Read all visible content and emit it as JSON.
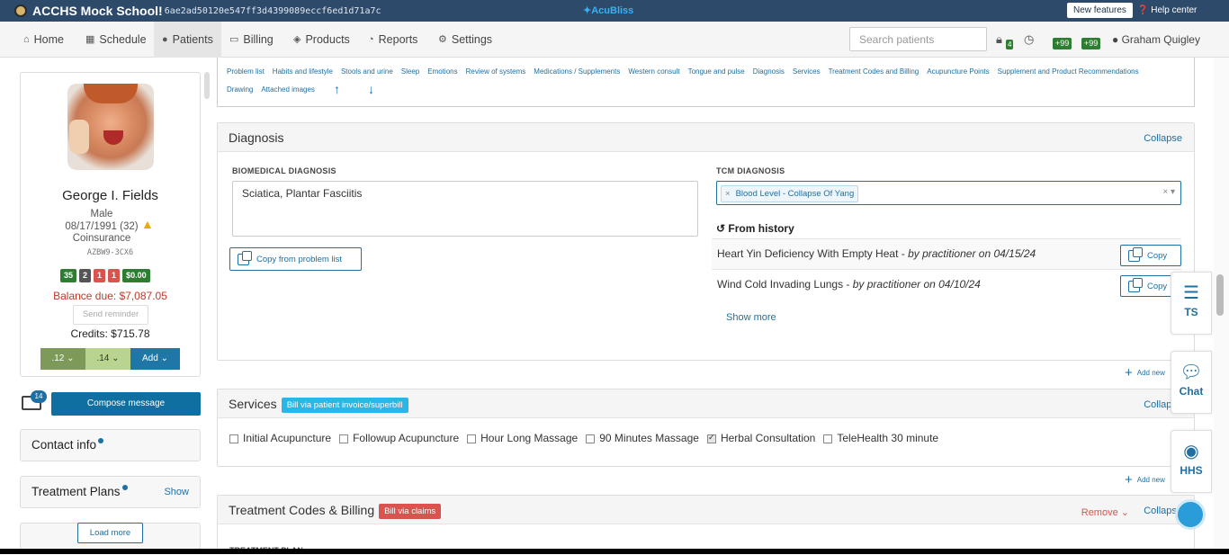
{
  "titlebar": {
    "school": "ACCHS Mock School!",
    "hash": "6ae2ad50120e547ff3d4399089eccf6ed1d71a7c",
    "brand": "AcuBliss",
    "new_features": "New features",
    "help_center": "Help center"
  },
  "nav": {
    "items": [
      {
        "label": "Home",
        "icon": "home-icon"
      },
      {
        "label": "Schedule",
        "icon": "calendar-icon"
      },
      {
        "label": "Patients",
        "icon": "person-icon"
      },
      {
        "label": "Billing",
        "icon": "billing-icon"
      },
      {
        "label": "Products",
        "icon": "box-icon"
      },
      {
        "label": "Reports",
        "icon": "pie-icon"
      },
      {
        "label": "Settings",
        "icon": "gear-icon"
      }
    ],
    "search_placeholder": "Search patients",
    "badge_lock": "4",
    "badge_a": "+99",
    "badge_b": "+99",
    "user": "Graham Quigley"
  },
  "patient": {
    "name": "George I. Fields",
    "sex": "Male",
    "dob": "08/17/1991 (32)",
    "insurance": "Coinsurance",
    "id": "AZBW9-3CX6",
    "chips": [
      {
        "label": "35",
        "color": "#2e7d32"
      },
      {
        "label": "2",
        "color": "#555555"
      },
      {
        "label": "1",
        "color": "#d9534f"
      },
      {
        "label": "1",
        "color": "#d9534f"
      },
      {
        "label": "$0.00",
        "color": "#2e7d32"
      }
    ],
    "balance": "Balance due: $7,087.05",
    "send_reminder": "Send reminder",
    "credits": "Credits: $715.78",
    "btn1": ".12",
    "btn2": ".14",
    "btn3": "Add"
  },
  "messages": {
    "count": "14",
    "compose": "Compose message"
  },
  "left_panels": {
    "contact": "Contact info",
    "plans": "Treatment Plans",
    "plans_show": "Show",
    "load_more": "Load more"
  },
  "section_nav": {
    "row1": [
      "Problem list",
      "Habits and lifestyle",
      "Stools and urine",
      "Sleep",
      "Emotions",
      "Review of systems",
      "Medications / Supplements",
      "Western consult",
      "Tongue and pulse",
      "Diagnosis",
      "Services",
      "Treatment Codes and Billing",
      "Acupuncture Points",
      "Supplement and Product Recommendations"
    ],
    "row2": [
      "Drawing",
      "Attached images"
    ]
  },
  "diagnosis": {
    "title": "Diagnosis",
    "collapse": "Collapse",
    "bio_label": "BIOMEDICAL DIAGNOSIS",
    "bio_value": "Sciatica, Plantar Fasciitis",
    "copy_problem": "Copy from problem list",
    "tcm_label": "TCM DIAGNOSIS",
    "tcm_tag": "Blood Level - Collapse Of Yang",
    "from_history": "From history",
    "history": [
      {
        "text": "Heart Yin Deficiency With Empty Heat - ",
        "by": "by practitioner on 04/15/24",
        "copy": "Copy"
      },
      {
        "text": "Wind Cold Invading Lungs - ",
        "by": "by practitioner on 04/10/24",
        "copy": "Copy"
      }
    ],
    "show_more": "Show more",
    "add_new": "Add new"
  },
  "services": {
    "title": "Services",
    "badge": "Bill via patient invoice/superbill",
    "collapse": "Collapse",
    "items": [
      {
        "label": "Initial Acupuncture",
        "checked": false
      },
      {
        "label": "Followup Acupuncture",
        "checked": false
      },
      {
        "label": "Hour Long Massage",
        "checked": false
      },
      {
        "label": "90 Minutes Massage",
        "checked": false
      },
      {
        "label": "Herbal Consultation",
        "checked": true
      },
      {
        "label": "TeleHealth 30 minute",
        "checked": false
      }
    ],
    "add_new": "Add new"
  },
  "codes": {
    "title": "Treatment Codes & Billing",
    "badge": "Bill via claims",
    "remove": "Remove",
    "collapse": "Collapse",
    "tplan": "TREATMENT PLAN"
  },
  "right_float": {
    "ts": "TS",
    "chat": "Chat",
    "hhs": "HHS"
  },
  "colors": {
    "primary": "#1e6fa3",
    "service_badge": "#29b6e8",
    "claims_badge": "#d9534f",
    "titlebar": "#2e4a6b"
  }
}
